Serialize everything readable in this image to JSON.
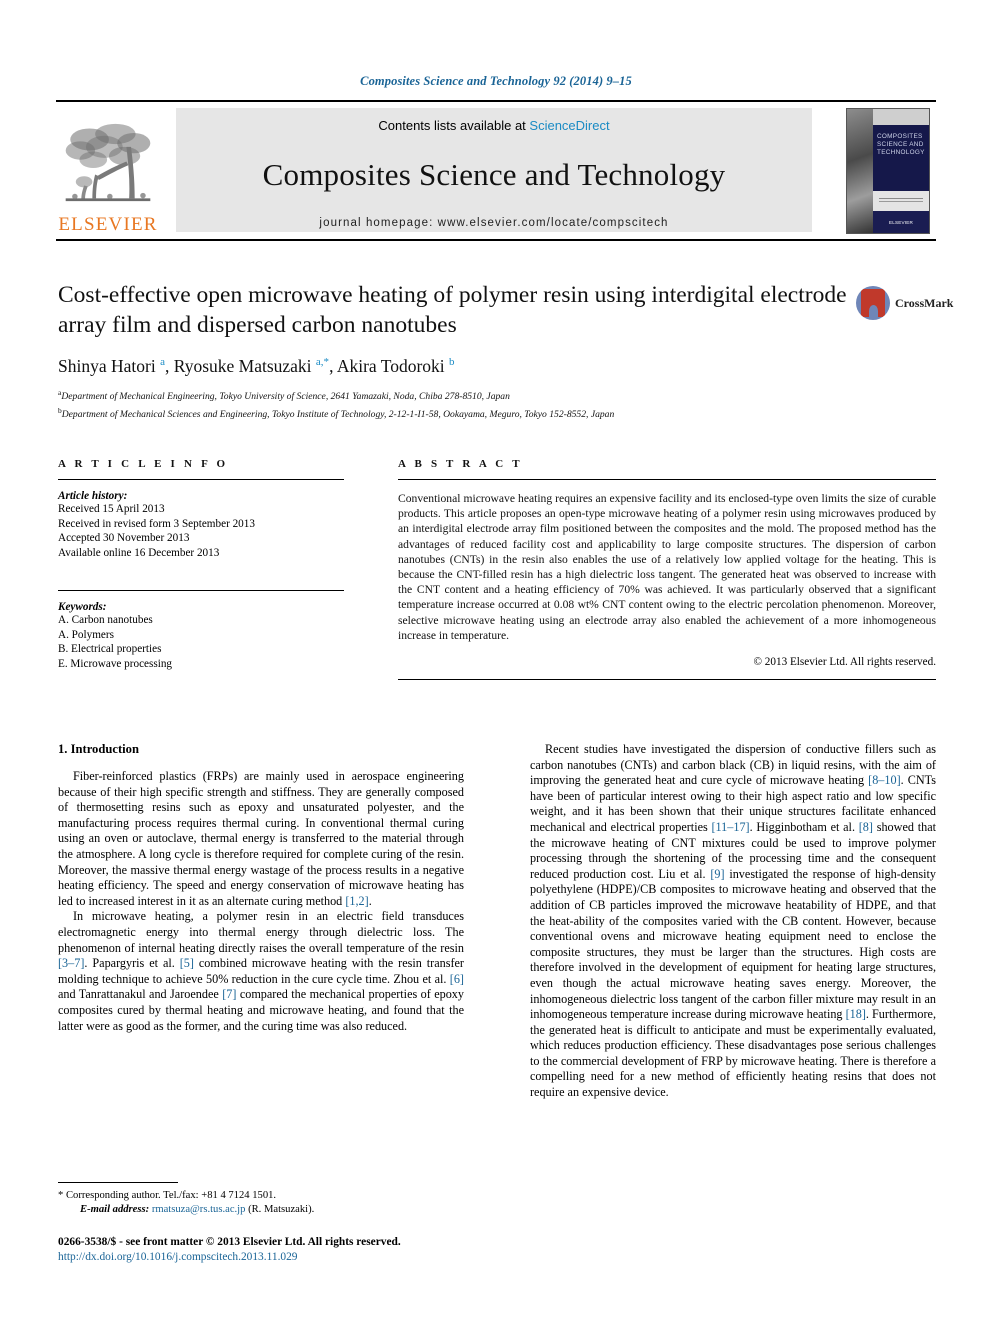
{
  "running_head": "Composites Science and Technology 92 (2014) 9–15",
  "masthead": {
    "contents_prefix": "Contents lists available at ",
    "sciencedirect": "ScienceDirect",
    "journal_title": "Composites Science and Technology",
    "homepage": "journal homepage: www.elsevier.com/locate/compscitech",
    "publisher_logo_text": "ELSEVIER",
    "cover_title": "COMPOSITES SCIENCE AND TECHNOLOGY",
    "cover_footer": "ELSEVIER"
  },
  "article": {
    "title": "Cost-effective open microwave heating of polymer resin using interdigital electrode array film and dispersed carbon nanotubes",
    "crossmark_label": "CrossMark",
    "authors_html": "Shinya Hatori <sup>a</sup>, Ryosuke Matsuzaki <sup>a,*</sup>, Akira Todoroki <sup>b</sup>",
    "affiliations": [
      "Department of Mechanical Engineering, Tokyo University of Science, 2641 Yamazaki, Noda, Chiba 278-8510, Japan",
      "Department of Mechanical Sciences and Engineering, Tokyo Institute of Technology, 2-12-1-I1-58, Ookayama, Meguro, Tokyo 152-8552, Japan"
    ],
    "affiliation_marks": [
      "a",
      "b"
    ]
  },
  "article_info": {
    "heading": "A R T I C L E    I N F O",
    "history_label": "Article history:",
    "history": [
      "Received 15 April 2013",
      "Received in revised form 3 September 2013",
      "Accepted 30 November 2013",
      "Available online 16 December 2013"
    ],
    "keywords_label": "Keywords:",
    "keywords": [
      "A. Carbon nanotubes",
      "A. Polymers",
      "B. Electrical properties",
      "E. Microwave processing"
    ]
  },
  "abstract": {
    "heading": "A B S T R A C T",
    "text": "Conventional microwave heating requires an expensive facility and its enclosed-type oven limits the size of curable products. This article proposes an open-type microwave heating of a polymer resin using microwaves produced by an interdigital electrode array film positioned between the composites and the mold. The proposed method has the advantages of reduced facility cost and applicability to large composite structures. The dispersion of carbon nanotubes (CNTs) in the resin also enables the use of a relatively low applied voltage for the heating. This is because the CNT-filled resin has a high dielectric loss tangent. The generated heat was observed to increase with the CNT content and a heating efficiency of 70% was achieved. It was particularly observed that a significant temperature increase occurred at 0.08 wt% CNT content owing to the electric percolation phenomenon. Moreover, selective microwave heating using an electrode array also enabled the achievement of a more inhomogeneous increase in temperature.",
    "copyright": "© 2013 Elsevier Ltd. All rights reserved."
  },
  "body": {
    "section_title": "1. Introduction",
    "left_paragraphs": [
      "Fiber-reinforced plastics (FRPs) are mainly used in aerospace engineering because of their high specific strength and stiffness. They are generally composed of thermosetting resins such as epoxy and unsaturated polyester, and the manufacturing process requires thermal curing. In conventional thermal curing using an oven or autoclave, thermal energy is transferred to the material through the atmosphere. A long cycle is therefore required for complete curing of the resin. Moreover, the massive thermal energy wastage of the process results in a negative heating efficiency. The speed and energy conservation of microwave heating has led to increased interest in it as an alternate curing method [1,2].",
      "In microwave heating, a polymer resin in an electric field transduces electromagnetic energy into thermal energy through dielectric loss. The phenomenon of internal heating directly raises the overall temperature of the resin [3–7]. Papargyris et al. [5] combined microwave heating with the resin transfer molding technique to achieve 50% reduction in the cure cycle time. Zhou et al. [6] and Tanrattanakul and Jaroendee [7] compared the mechanical properties of epoxy composites cured by thermal heating and microwave heating, and found that the latter were as good as the former, and the curing time was also reduced."
    ],
    "right_paragraphs": [
      "Recent studies have investigated the dispersion of conductive fillers such as carbon nanotubes (CNTs) and carbon black (CB) in liquid resins, with the aim of improving the generated heat and cure cycle of microwave heating [8–10]. CNTs have been of particular interest owing to their high aspect ratio and low specific weight, and it has been shown that their unique structures facilitate enhanced mechanical and electrical properties [11–17]. Higginbotham et al. [8] showed that the microwave heating of CNT mixtures could be used to improve polymer processing through the shortening of the processing time and the consequent reduced production cost. Liu et al. [9] investigated the response of high-density polyethylene (HDPE)/CB composites to microwave heating and observed that the addition of CB particles improved the microwave heatability of HDPE, and that the heat-ability of the composites varied with the CB content. However, because conventional ovens and microwave heating equipment need to enclose the composite structures, they must be larger than the structures. High costs are therefore involved in the development of equipment for heating large structures, even though the actual microwave heating saves energy. Moreover, the inhomogeneous dielectric loss tangent of the carbon filler mixture may result in an inhomogeneous temperature increase during microwave heating [18]. Furthermore, the generated heat is difficult to anticipate and must be experimentally evaluated, which reduces production efficiency. These disadvantages pose serious challenges to the commercial development of FRP by microwave heating. There is therefore a compelling need for a new method of efficiently heating resins that does not require an expensive device."
    ]
  },
  "footer": {
    "corresponding_marker": "*",
    "corresponding_text": "Corresponding author. Tel./fax: +81 4 7124 1501.",
    "email_label": "E-mail address:",
    "email": "rmatsuza@rs.tus.ac.jp",
    "email_owner": "(R. Matsuzaki).",
    "issn_line": "0266-3538/$ - see front matter © 2013 Elsevier Ltd. All rights reserved.",
    "doi": "http://dx.doi.org/10.1016/j.compscitech.2013.11.029"
  },
  "colors": {
    "link": "#1a6496",
    "sciencedirect": "#1a8bc4",
    "elsevier_orange": "#E87722",
    "masthead_bg": "#e6e6e6"
  }
}
